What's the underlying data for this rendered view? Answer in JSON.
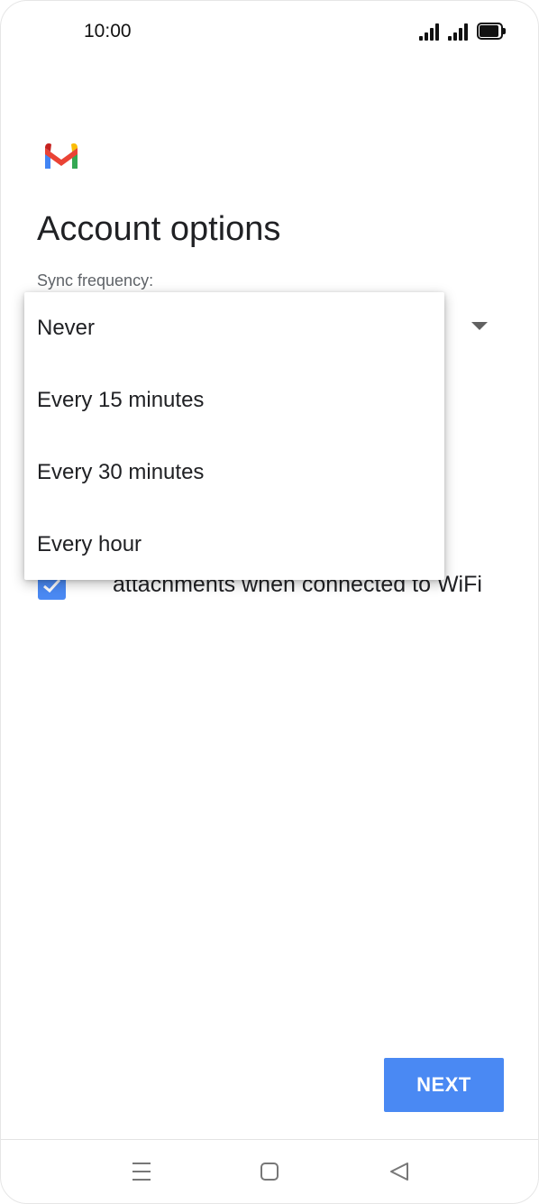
{
  "status_bar": {
    "time": "10:00",
    "icons": [
      "signal-icon",
      "signal-icon",
      "battery-icon"
    ]
  },
  "header": {
    "logo": "gmail-logo-icon",
    "title": "Account options"
  },
  "sync": {
    "label": "Sync frequency:",
    "arrow_icon": "dropdown-arrow-icon",
    "options": [
      "Never",
      "Every 15 minutes",
      "Every 30 minutes",
      "Every hour"
    ]
  },
  "checkbox": {
    "checked": true,
    "label": "attachments when connected to WiFi"
  },
  "actions": {
    "next_label": "NEXT"
  },
  "nav_bar": {
    "icons": [
      "menu-icon",
      "home-icon",
      "back-icon"
    ]
  },
  "colors": {
    "accent": "#4a89f3",
    "gmail_red": "#ea4335",
    "gmail_blue": "#4285f4",
    "gmail_green": "#34a853",
    "gmail_yellow": "#fbbc04",
    "gmail_dark_red": "#c5221f"
  }
}
